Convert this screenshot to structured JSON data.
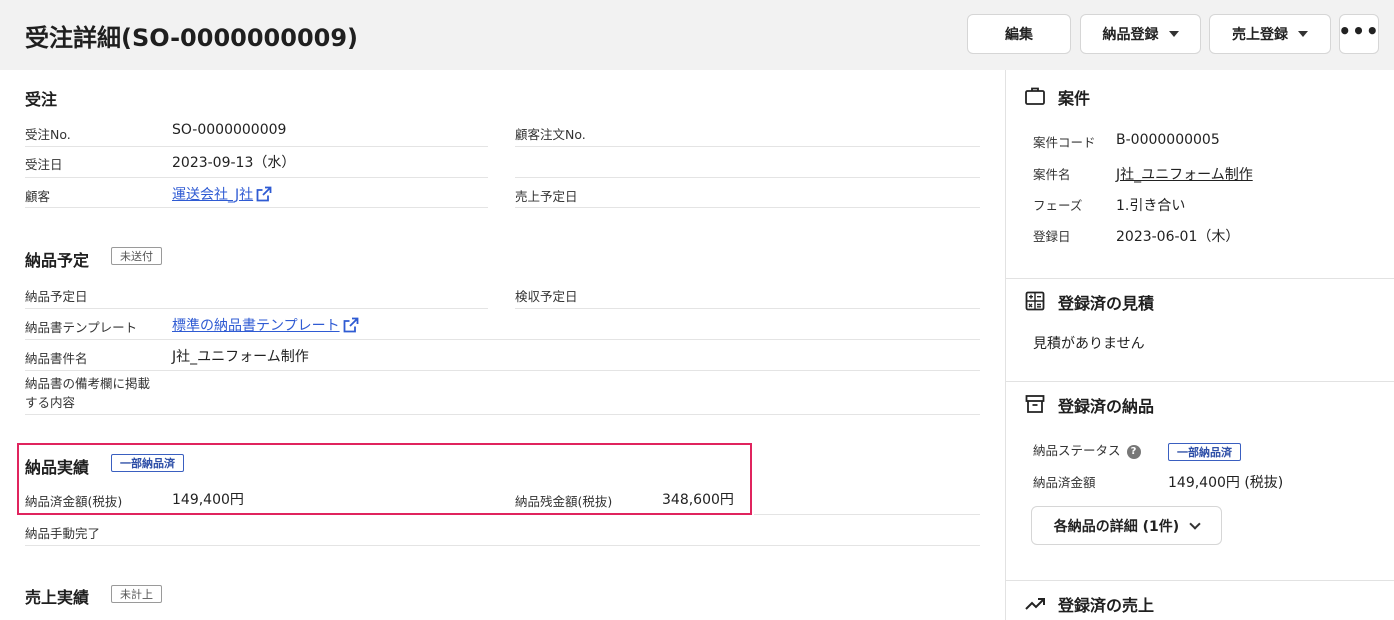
{
  "header": {
    "title": "受注詳細(SO-0000000009)",
    "edit_label": "編集",
    "delivery_register_label": "納品登録",
    "sales_register_label": "売上登録",
    "more_label": "•••"
  },
  "order": {
    "title": "受注",
    "order_no_label": "受注No.",
    "order_no_value": "SO-0000000009",
    "customer_order_no_label": "顧客注文No.",
    "order_date_label": "受注日",
    "order_date_value": "2023-09-13（水）",
    "customer_label": "顧客",
    "customer_value": "運送会社_J社",
    "sales_date_label": "売上予定日"
  },
  "delivery_plan": {
    "title": "納品予定",
    "badge": "未送付",
    "delivery_date_label": "納品予定日",
    "inspection_date_label": "検収予定日",
    "template_label": "納品書テンプレート",
    "template_value": "標準の納品書テンプレート",
    "doc_name_label": "納品書件名",
    "doc_name_value": "J社_ユニフォーム制作",
    "remarks_label_1": "納品書の備考欄に掲載",
    "remarks_label_2": "する内容"
  },
  "delivery_actual": {
    "title": "納品実績",
    "badge": "一部納品済",
    "delivered_label": "納品済金額(税抜)",
    "delivered_value": "149,400円",
    "remaining_label": "納品残金額(税抜)",
    "remaining_value": "348,600円",
    "manual_complete_label": "納品手動完了"
  },
  "sales_actual": {
    "title": "売上実績",
    "badge": "未計上"
  },
  "right_panel": {
    "project": {
      "title": "案件",
      "code_label": "案件コード",
      "code_value": "B-0000000005",
      "name_label": "案件名",
      "name_value": "J社_ユニフォーム制作",
      "phase_label": "フェーズ",
      "phase_value": "1.引き合い",
      "date_label": "登録日",
      "date_value": "2023-06-01（木）"
    },
    "estimates": {
      "title": "登録済の見積",
      "empty": "見積がありません"
    },
    "deliveries": {
      "title": "登録済の納品",
      "status_label": "納品ステータス",
      "status_badge": "一部納品済",
      "amount_label": "納品済金額",
      "amount_value": "149,400円 (税抜)",
      "detail_button": "各納品の詳細 (1件)"
    },
    "sales": {
      "title": "登録済の売上"
    }
  },
  "colors": {
    "accent_link": "#2f5bd3",
    "highlight_border": "#e0245e",
    "header_bg": "#f2f2f2"
  }
}
